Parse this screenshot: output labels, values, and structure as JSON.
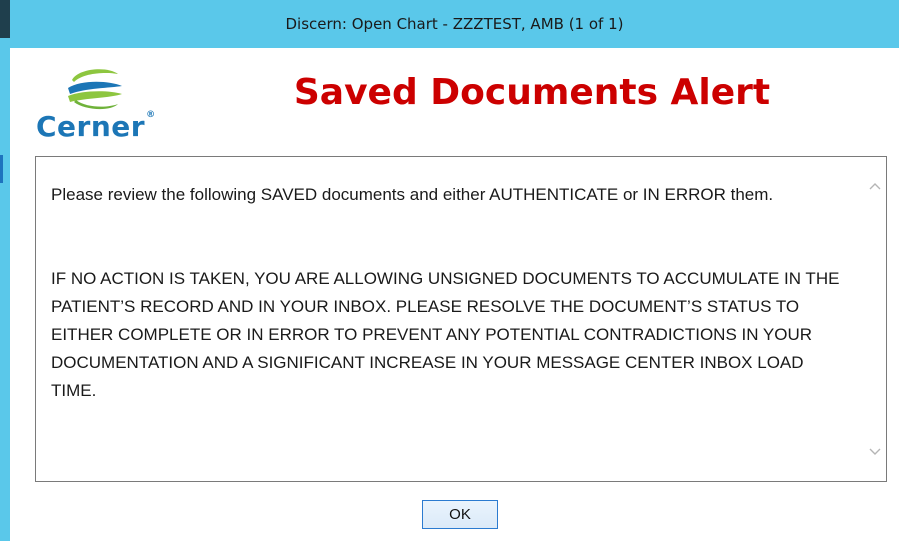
{
  "window": {
    "title": "Discern: Open Chart - ZZZTEST, AMB (1 of 1)"
  },
  "logo": {
    "text": "Cerner",
    "trademark": "®",
    "colors": {
      "green": "#8dc63f",
      "blue": "#1c76b6"
    }
  },
  "alert": {
    "title": "Saved Documents Alert",
    "title_color": "#cc0000",
    "paragraphs": [
      "Please review the following SAVED documents and either AUTHENTICATE or IN ERROR them.",
      "IF NO ACTION IS TAKEN, YOU ARE ALLOWING UNSIGNED DOCUMENTS TO ACCUMULATE IN THE PATIENT’S RECORD AND IN YOUR INBOX. PLEASE RESOLVE THE DOCUMENT’S STATUS TO EITHER COMPLETE OR IN ERROR TO PREVENT ANY POTENTIAL CONTRADICTIONS IN YOUR DOCUMENTATION AND A SIGNIFICANT INCREASE IN YOUR MESSAGE CENTER INBOX LOAD TIME."
    ]
  },
  "scrollbar": {
    "up_icon": "chevron-up-icon",
    "down_icon": "chevron-down-icon"
  },
  "buttons": {
    "ok_label": "OK"
  },
  "theme": {
    "titlebar_color": "#5ac8ea",
    "button_border": "#2b7bd0"
  }
}
